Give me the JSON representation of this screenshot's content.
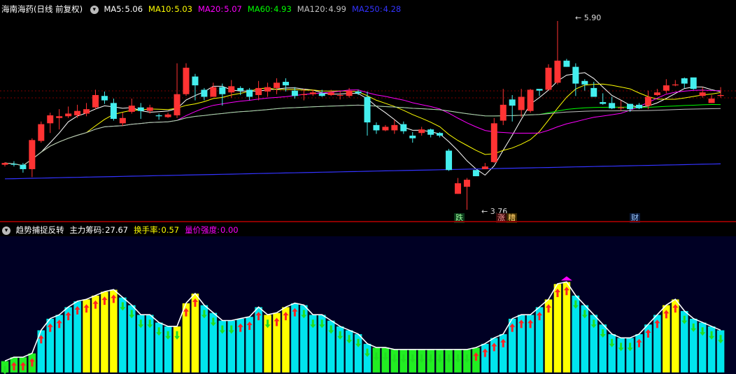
{
  "main_panel": {
    "title": "海南海药(日线 前复权)",
    "indicators": [
      {
        "label": "MA5:",
        "value": "5.06",
        "color": "#ffffff"
      },
      {
        "label": "MA10:",
        "value": "5.03",
        "color": "#ffff00"
      },
      {
        "label": "MA20:",
        "value": "5.07",
        "color": "#ff00ff"
      },
      {
        "label": "MA60:",
        "value": "4.93",
        "color": "#00ff00"
      },
      {
        "label": "MA120:",
        "value": "4.99",
        "color": "#c0c0c0"
      },
      {
        "label": "MA250:",
        "value": "4.28",
        "color": "#3333ff"
      }
    ],
    "high_label": "5.90",
    "low_label": "3.76",
    "event_badges": [
      {
        "text": "跌",
        "bg": "#0a3a1a",
        "color": "#9cff9c"
      },
      {
        "text": "涨",
        "bg": "#3a0a0a",
        "color": "#ff9c9c"
      },
      {
        "text": "糟",
        "bg": "#3a2a00",
        "color": "#ffcc66"
      },
      {
        "text": "财",
        "bg": "#0a1a3a",
        "color": "#9cc8ff"
      }
    ]
  },
  "sub_panel": {
    "title": "趋势捕捉反转",
    "indicators": [
      {
        "label": "主力筹码:",
        "value": "27.67",
        "color": "#ffffff"
      },
      {
        "label": "换手率:",
        "value": "0.57",
        "color": "#ffff00"
      },
      {
        "label": "量价强度:",
        "value": "0.00",
        "color": "#ff00ff"
      }
    ]
  },
  "chart_data": [
    {
      "type": "candlestick",
      "price_range": [
        3.76,
        5.9
      ],
      "candles": [
        [
          4.27,
          4.29,
          4.25,
          4.3
        ],
        [
          4.28,
          4.27,
          4.25,
          4.31
        ],
        [
          4.27,
          4.22,
          4.18,
          4.29
        ],
        [
          4.22,
          4.55,
          4.13,
          4.57
        ],
        [
          4.54,
          4.73,
          4.52,
          4.76
        ],
        [
          4.74,
          4.83,
          4.63,
          4.86
        ],
        [
          4.8,
          4.82,
          4.67,
          4.9
        ],
        [
          4.82,
          4.85,
          4.8,
          4.93
        ],
        [
          4.83,
          4.88,
          4.8,
          4.95
        ],
        [
          4.85,
          4.9,
          4.82,
          4.97
        ],
        [
          4.92,
          5.06,
          4.9,
          5.12
        ],
        [
          5.05,
          5.0,
          4.96,
          5.1
        ],
        [
          4.97,
          4.79,
          4.77,
          5.02
        ],
        [
          4.74,
          4.8,
          4.71,
          4.86
        ],
        [
          4.87,
          4.94,
          4.85,
          5.02
        ],
        [
          4.92,
          4.88,
          4.79,
          4.97
        ],
        [
          4.88,
          4.92,
          4.85,
          4.95
        ],
        [
          4.83,
          4.82,
          4.78,
          4.85
        ],
        [
          4.81,
          4.84,
          4.8,
          4.86
        ],
        [
          4.83,
          5.07,
          4.8,
          5.42
        ],
        [
          5.07,
          5.37,
          5.05,
          5.42
        ],
        [
          5.27,
          5.17,
          5.0,
          5.3
        ],
        [
          5.12,
          5.04,
          5.0,
          5.14
        ],
        [
          5.04,
          5.15,
          5.04,
          5.2
        ],
        [
          5.15,
          5.07,
          4.94,
          5.19
        ],
        [
          5.09,
          5.16,
          5.03,
          5.23
        ],
        [
          5.14,
          5.11,
          5.06,
          5.16
        ],
        [
          5.12,
          5.04,
          5.0,
          5.14
        ],
        [
          5.06,
          5.14,
          5.0,
          5.22
        ],
        [
          5.1,
          5.15,
          5.04,
          5.2
        ],
        [
          5.14,
          5.2,
          5.07,
          5.25
        ],
        [
          5.21,
          5.17,
          5.1,
          5.25
        ],
        [
          5.11,
          5.05,
          5.02,
          5.15
        ],
        [
          5.06,
          5.07,
          5.0,
          5.13
        ],
        [
          5.07,
          5.09,
          5.05,
          5.12
        ],
        [
          5.08,
          5.05,
          5.04,
          5.12
        ],
        [
          5.06,
          5.09,
          5.05,
          5.12
        ],
        [
          5.06,
          5.06,
          5.01,
          5.1
        ],
        [
          5.05,
          5.11,
          5.03,
          5.14
        ],
        [
          5.1,
          5.08,
          5.06,
          5.12
        ],
        [
          5.04,
          4.75,
          4.6,
          5.1
        ],
        [
          4.72,
          4.66,
          4.62,
          4.75
        ],
        [
          4.66,
          4.7,
          4.65,
          4.72
        ],
        [
          4.66,
          4.72,
          4.62,
          4.78
        ],
        [
          4.73,
          4.65,
          4.62,
          4.76
        ],
        [
          4.6,
          4.57,
          4.52,
          4.64
        ],
        [
          4.63,
          4.67,
          4.6,
          4.7
        ],
        [
          4.67,
          4.61,
          4.58,
          4.68
        ],
        [
          4.63,
          4.6,
          4.58,
          4.64
        ],
        [
          4.43,
          4.21,
          4.2,
          4.45
        ],
        [
          3.94,
          4.06,
          3.94,
          4.12
        ],
        [
          4.02,
          4.1,
          3.76,
          4.12
        ],
        [
          4.21,
          4.14,
          4.14,
          4.18
        ],
        [
          4.22,
          4.25,
          4.24,
          4.29
        ],
        [
          4.3,
          4.74,
          4.29,
          4.8
        ],
        [
          4.77,
          4.95,
          4.72,
          5.13
        ],
        [
          5.01,
          4.94,
          4.76,
          5.06
        ],
        [
          4.89,
          5.04,
          4.81,
          5.13
        ],
        [
          4.88,
          5.12,
          4.86,
          5.13
        ],
        [
          5.13,
          5.11,
          5.05,
          5.12
        ],
        [
          5.12,
          5.37,
          5.12,
          5.41
        ],
        [
          5.2,
          5.45,
          5.18,
          5.9
        ],
        [
          5.45,
          5.38,
          5.38,
          5.47
        ],
        [
          5.38,
          5.19,
          5.05,
          5.42
        ],
        [
          5.22,
          5.18,
          5.11,
          5.24
        ],
        [
          5.14,
          5.04,
          5.06,
          5.21
        ],
        [
          4.98,
          4.96,
          4.95,
          5.08
        ],
        [
          4.97,
          4.91,
          4.9,
          5.04
        ],
        [
          4.91,
          4.92,
          4.88,
          5.0
        ],
        [
          4.96,
          4.9,
          4.87,
          4.96
        ],
        [
          4.95,
          4.91,
          4.9,
          4.97
        ],
        [
          4.94,
          5.04,
          4.9,
          5.11
        ],
        [
          5.06,
          5.09,
          5.05,
          5.13
        ],
        [
          5.11,
          5.17,
          5.08,
          5.24
        ],
        [
          5.17,
          5.18,
          5.16,
          5.23
        ],
        [
          5.25,
          5.19,
          5.14,
          5.26
        ],
        [
          5.26,
          5.13,
          5.12,
          5.19
        ],
        [
          5.05,
          5.09,
          5.03,
          5.15
        ],
        [
          4.97,
          5.02,
          4.97,
          5.06
        ],
        [
          5.05,
          5.06,
          5.03,
          5.15
        ]
      ],
      "series": [
        {
          "name": "MA5",
          "color": "#ffffff"
        },
        {
          "name": "MA10",
          "color": "#ffff00"
        },
        {
          "name": "MA20",
          "color": "#ff00ff"
        },
        {
          "name": "MA60",
          "color": "#00ff00"
        },
        {
          "name": "MA120",
          "color": "#c0c0c0"
        },
        {
          "name": "MA250",
          "color": "#3333ff"
        }
      ]
    },
    {
      "type": "bar",
      "series": [
        {
          "name": "主力筹码",
          "color": "#00e5ee",
          "values": [
            6,
            8,
            8,
            10,
            22,
            28,
            30,
            34,
            37,
            38,
            40,
            42,
            43,
            39,
            35,
            30,
            30,
            26,
            24,
            24,
            36,
            41,
            35,
            31,
            27,
            27,
            28,
            29,
            34,
            30,
            31,
            34,
            36,
            35,
            30,
            30,
            27,
            24,
            22,
            20,
            15,
            13,
            13,
            12,
            12,
            12,
            12,
            12,
            12,
            12,
            12,
            12,
            13,
            15,
            18,
            20,
            28,
            30,
            30,
            34,
            38,
            46,
            47,
            40,
            35,
            30,
            25,
            20,
            18,
            18,
            20,
            25,
            30,
            35,
            38,
            32,
            28,
            26,
            24,
            22
          ]
        },
        {
          "name": "量价强度",
          "color": "#ff00ff"
        }
      ],
      "colors": {
        "cyan": "#00e5ee",
        "green": "#22ee22",
        "yellow": "#ffff00",
        "up_arrow": "#ff2222",
        "down_arrow": "#22dd22"
      }
    }
  ]
}
